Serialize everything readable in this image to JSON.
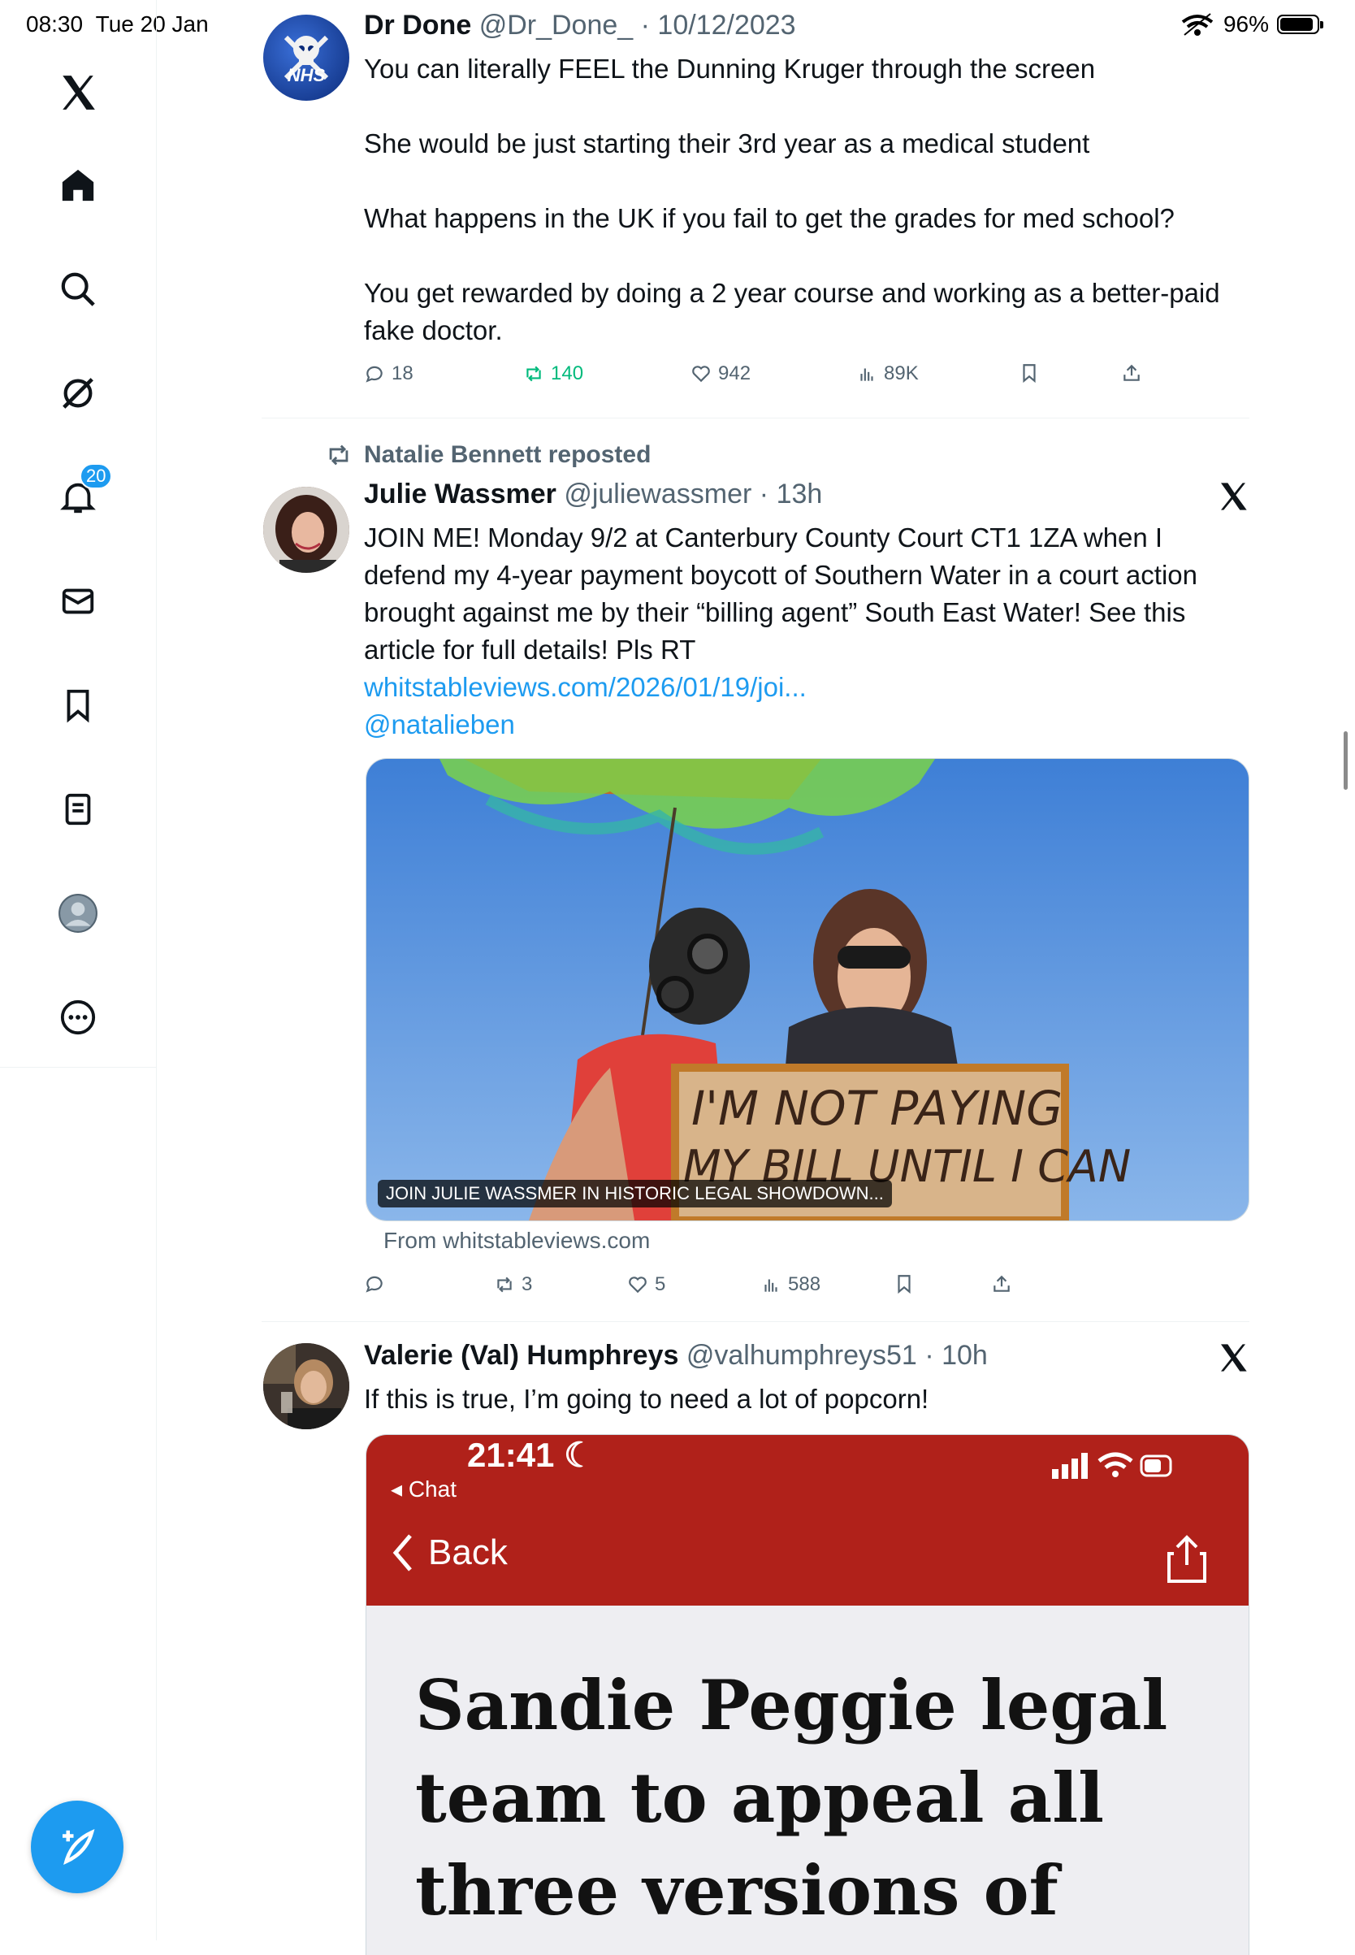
{
  "status_bar": {
    "time": "08:30",
    "date": "Tue 20 Jan",
    "battery": "96%"
  },
  "sidebar": {
    "items": [
      {
        "name": "x-logo"
      },
      {
        "name": "home"
      },
      {
        "name": "search"
      },
      {
        "name": "grok"
      },
      {
        "name": "notifications",
        "badge": "20"
      },
      {
        "name": "messages"
      },
      {
        "name": "bookmarks"
      },
      {
        "name": "lists"
      },
      {
        "name": "profile"
      },
      {
        "name": "more"
      }
    ],
    "notifications_badge": "20"
  },
  "tweets": [
    {
      "name": "Dr Done",
      "handle": "@Dr_Done_",
      "sep": "·",
      "time": "10/12/2023",
      "avatar_text": "NHS",
      "paragraphs": [
        "You can literally FEEL the Dunning Kruger through the screen",
        "She would be just starting their 3rd year as a medical student",
        "What happens in the UK if you fail to get the grades for med school?",
        "You get rewarded by doing a 2 year course and working as a better-paid fake doctor."
      ],
      "stats": {
        "replies": "18",
        "reposts": "140",
        "likes": "942",
        "views": "89K"
      }
    },
    {
      "repost_by": "Natalie Bennett reposted",
      "name": "Julie Wassmer",
      "handle": "@juliewassmer",
      "sep": "·",
      "time": "13h",
      "text": "JOIN ME! Monday 9/2 at Canterbury County Court CT1 1ZA when I defend my 4-year payment boycott of Southern Water in a court action brought against me by their “billing agent” South East Water! See this article for full details! Pls RT",
      "link": "whitstableviews.com/2026/01/19/joi...",
      "mention": "@natalieben",
      "card": {
        "caption": "JOIN JULIE WASSMER IN HISTORIC LEGAL SHOWDOWN...",
        "sign_line1": "I'M NOT PAYING",
        "sign_line2": "MY BILL UNTIL I CAN",
        "from": "From whitstableviews.com"
      },
      "stats": {
        "replies": "",
        "reposts": "3",
        "likes": "5",
        "views": "588"
      }
    },
    {
      "name": "Valerie (Val) Humphreys",
      "handle": "@valhumphreys51",
      "sep": "·",
      "time": "10h",
      "text": "If this is true, I’m going to need a lot of popcorn!",
      "embed": {
        "time": "21:41",
        "chat": "◂ Chat",
        "back": "Back",
        "headline": "Sandie Peggie legal team to appeal all three versions of"
      }
    }
  ],
  "colors": {
    "accent": "#1d9bf0",
    "repost_green": "#00ba7c",
    "text": "#0f1419",
    "secondary": "#536471",
    "embed_red": "#b0211a"
  }
}
